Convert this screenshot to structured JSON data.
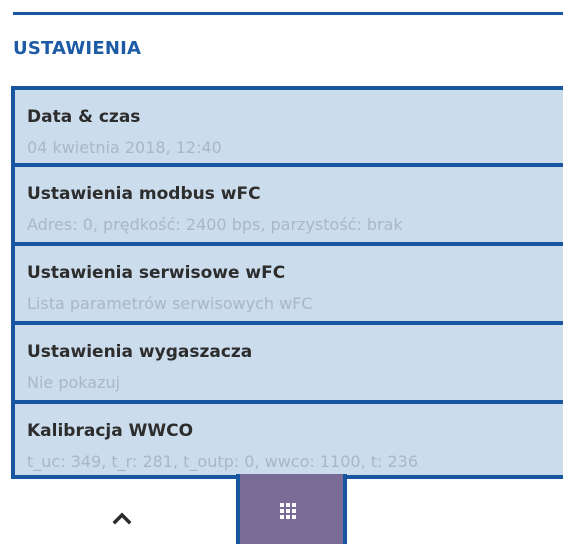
{
  "header": {
    "title": "USTAWIENIA"
  },
  "settings": {
    "items": [
      {
        "title": "Data & czas",
        "subtitle": "04 kwietnia 2018, 12:40"
      },
      {
        "title": "Ustawienia modbus wFC",
        "subtitle": "Adres: 0, prędkość: 2400 bps, parzystość: brak"
      },
      {
        "title": "Ustawienia serwisowe wFC",
        "subtitle": "Lista parametrów serwisowych wFC"
      },
      {
        "title": "Ustawienia wygaszacza",
        "subtitle": "Nie pokazuj"
      },
      {
        "title": "Kalibracja WWCO",
        "subtitle": "t_uc: 349, t_r: 281, t_outp: 0, wwco: 1100, t: 236"
      }
    ]
  },
  "nav": {
    "up_icon": "chevron-up-icon",
    "menu_icon": "grid-icon"
  },
  "colors": {
    "accent": "#1857a0",
    "item_bg": "#cbdcec",
    "menu_button_bg": "#7a6a96",
    "subtitle_text": "#a9b7c6"
  }
}
